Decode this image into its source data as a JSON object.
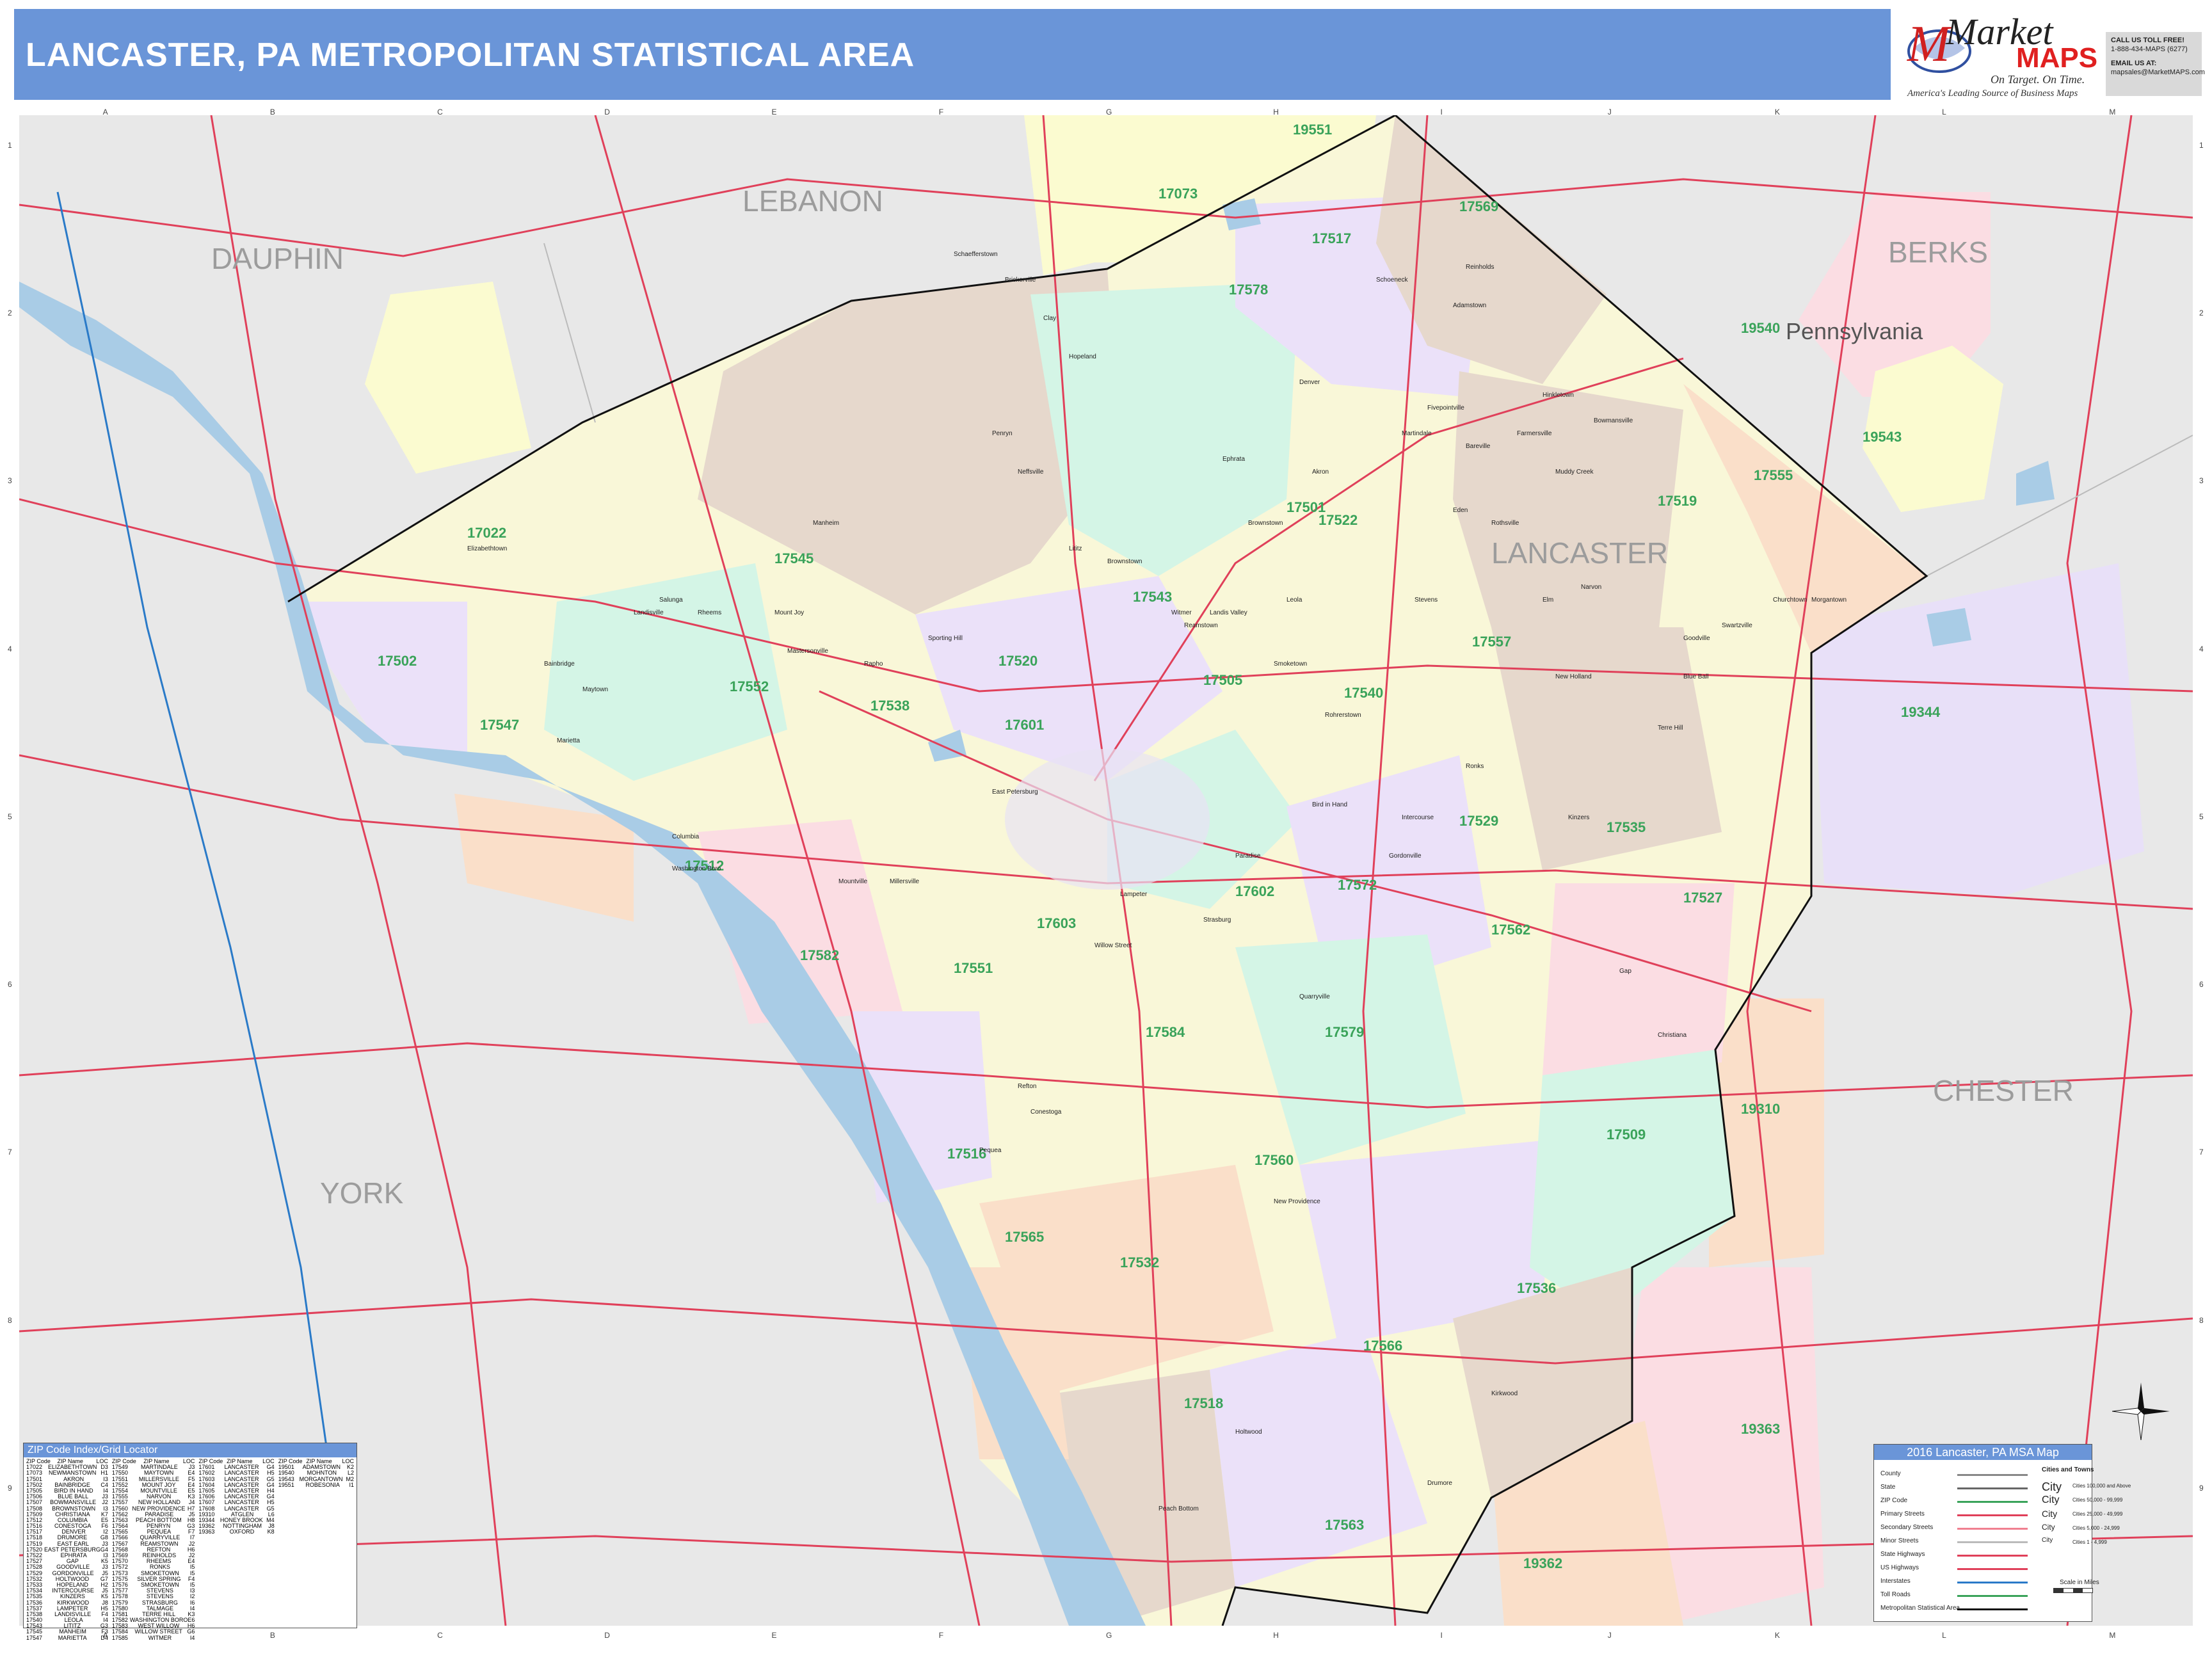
{
  "header": {
    "title": "LANCASTER, PA METROPOLITAN STATISTICAL AREA"
  },
  "logo": {
    "market": "Market",
    "maps": "MAPS",
    "tagline": "On Target. On Time.",
    "subtitle": "America's Leading Source of Business Maps"
  },
  "contact": {
    "line1": "CALL US TOLL FREE!",
    "line2": "1-888-434-MAPS (6277)",
    "line3": "EMAIL US AT:",
    "line4": "mapsales@MarketMAPS.com"
  },
  "grid": {
    "columns": [
      "A",
      "B",
      "C",
      "D",
      "E",
      "F",
      "G",
      "H",
      "I",
      "J",
      "K",
      "L",
      "M"
    ],
    "rows": [
      "1",
      "2",
      "3",
      "4",
      "5",
      "6",
      "7",
      "8",
      "9"
    ]
  },
  "counties": [
    {
      "name": "LEBANON"
    },
    {
      "name": "DAUPHIN"
    },
    {
      "name": "BERKS"
    },
    {
      "name": "LANCASTER"
    },
    {
      "name": "CHESTER"
    },
    {
      "name": "YORK"
    }
  ],
  "state_label": "Pennsylvania",
  "zip_codes": [
    "19551",
    "17073",
    "17569",
    "17517",
    "17578",
    "19540",
    "19543",
    "17555",
    "17519",
    "17522",
    "17501",
    "17022",
    "17545",
    "17543",
    "17502",
    "17552",
    "17538",
    "17601",
    "17520",
    "17505",
    "17540",
    "17557",
    "19344",
    "17547",
    "17512",
    "17603",
    "17529",
    "17535",
    "17527",
    "17602",
    "17572",
    "17562",
    "17582",
    "17551",
    "17584",
    "17579",
    "17509",
    "19310",
    "17516",
    "17560",
    "17565",
    "17532",
    "17536",
    "17566",
    "17518",
    "17563",
    "19362",
    "19363"
  ],
  "towns": [
    "Elizabethtown",
    "Mount Joy",
    "Manheim",
    "Lititz",
    "Ephrata",
    "Akron",
    "Denver",
    "Adamstown",
    "Reinholds",
    "Schoeneck",
    "Brownstown",
    "Leola",
    "Bird in Hand",
    "Intercourse",
    "Gordonville",
    "Paradise",
    "Strasburg",
    "Willow Street",
    "Millersville",
    "Columbia",
    "Marietta",
    "Maytown",
    "Bainbridge",
    "Landisville",
    "Salunga",
    "Rheems",
    "Quarryville",
    "Christiana",
    "Gap",
    "Kinzers",
    "Ronks",
    "Holtwood",
    "Peach Bottom",
    "Kirkwood",
    "Drumore",
    "New Providence",
    "Refton",
    "Lampeter",
    "Mountville",
    "Washington Boro",
    "Conestoga",
    "Pequea",
    "Narvon",
    "New Holland",
    "Blue Ball",
    "Terre Hill",
    "Goodville",
    "Churchtown",
    "Morgantown",
    "Elm",
    "Brickerville",
    "Schaefferstown",
    "Clay",
    "Hopeland",
    "Penryn",
    "Mastersonville",
    "Rapho",
    "Sporting Hill",
    "East Petersburg",
    "Neffsville",
    "Rohrerstown",
    "Landis Valley",
    "Witmer",
    "Smoketown",
    "Eden",
    "Rothsville",
    "Farmersville",
    "Bareville",
    "Hinkletown",
    "Martindale",
    "Fivepointville",
    "Bowmansville",
    "Muddy Creek",
    "Swartzville",
    "Reamstown",
    "Stevens",
    "Brownstown"
  ],
  "index": {
    "title": "ZIP Code Index/Grid Locator",
    "headers": [
      "ZIP Code",
      "ZIP Name",
      "LOC"
    ],
    "col1": [
      [
        "17022",
        "ELIZABETHTOWN",
        "D3"
      ],
      [
        "17073",
        "NEWMANSTOWN",
        "H1"
      ],
      [
        "17501",
        "AKRON",
        "I3"
      ],
      [
        "17502",
        "BAINBRIDGE",
        "C4"
      ],
      [
        "17505",
        "BIRD IN HAND",
        "I4"
      ],
      [
        "17506",
        "BLUE BALL",
        "J3"
      ],
      [
        "17507",
        "BOWMANSVILLE",
        "J2"
      ],
      [
        "17508",
        "BROWNSTOWN",
        "I3"
      ],
      [
        "17509",
        "CHRISTIANA",
        "K7"
      ],
      [
        "17512",
        "COLUMBIA",
        "E5"
      ],
      [
        "17516",
        "CONESTOGA",
        "F6"
      ],
      [
        "17517",
        "DENVER",
        "I2"
      ],
      [
        "17518",
        "DRUMORE",
        "G8"
      ],
      [
        "17519",
        "EAST EARL",
        "J3"
      ],
      [
        "17520",
        "EAST PETERSBURG",
        "G4"
      ],
      [
        "17522",
        "EPHRATA",
        "I3"
      ],
      [
        "17527",
        "GAP",
        "K5"
      ],
      [
        "17528",
        "GOODVILLE",
        "J3"
      ],
      [
        "17529",
        "GORDONVILLE",
        "J5"
      ],
      [
        "17532",
        "HOLTWOOD",
        "G7"
      ],
      [
        "17533",
        "HOPELAND",
        "H2"
      ],
      [
        "17534",
        "INTERCOURSE",
        "J5"
      ],
      [
        "17535",
        "KINZERS",
        "K5"
      ],
      [
        "17536",
        "KIRKWOOD",
        "J8"
      ],
      [
        "17537",
        "LAMPETER",
        "H5"
      ],
      [
        "17538",
        "LANDISVILLE",
        "F4"
      ],
      [
        "17540",
        "LEOLA",
        "I4"
      ],
      [
        "17543",
        "LITITZ",
        "G3"
      ],
      [
        "17545",
        "MANHEIM",
        "F3"
      ],
      [
        "17547",
        "MARIETTA",
        "D4"
      ]
    ],
    "col2": [
      [
        "17549",
        "MARTINDALE",
        "J3"
      ],
      [
        "17550",
        "MAYTOWN",
        "E4"
      ],
      [
        "17551",
        "MILLERSVILLE",
        "F5"
      ],
      [
        "17552",
        "MOUNT JOY",
        "E4"
      ],
      [
        "17554",
        "MOUNTVILLE",
        "E5"
      ],
      [
        "17555",
        "NARVON",
        "K3"
      ],
      [
        "17557",
        "NEW HOLLAND",
        "J4"
      ],
      [
        "17560",
        "NEW PROVIDENCE",
        "H7"
      ],
      [
        "17562",
        "PARADISE",
        "J5"
      ],
      [
        "17563",
        "PEACH BOTTOM",
        "H8"
      ],
      [
        "17564",
        "PENRYN",
        "G3"
      ],
      [
        "17565",
        "PEQUEA",
        "F7"
      ],
      [
        "17566",
        "QUARRYVILLE",
        "I7"
      ],
      [
        "17567",
        "REAMSTOWN",
        "J2"
      ],
      [
        "17568",
        "REFTON",
        "H6"
      ],
      [
        "17569",
        "REINHOLDS",
        "J2"
      ],
      [
        "17570",
        "RHEEMS",
        "E4"
      ],
      [
        "17572",
        "RONKS",
        "I5"
      ],
      [
        "17573",
        "SMOKETOWN",
        "I5"
      ],
      [
        "17575",
        "SILVER SPRING",
        "F4"
      ],
      [
        "17576",
        "SMOKETOWN",
        "I5"
      ],
      [
        "17577",
        "STEVENS",
        "I3"
      ],
      [
        "17578",
        "STEVENS",
        "I2"
      ],
      [
        "17579",
        "STRASBURG",
        "I6"
      ],
      [
        "17580",
        "TALMAGE",
        "I4"
      ],
      [
        "17581",
        "TERRE HILL",
        "K3"
      ],
      [
        "17582",
        "WASHINGTON BORO",
        "E6"
      ],
      [
        "17583",
        "WEST WILLOW",
        "H6"
      ],
      [
        "17584",
        "WILLOW STREET",
        "G6"
      ],
      [
        "17585",
        "WITMER",
        "I4"
      ]
    ],
    "col3": [
      [
        "17601",
        "LANCASTER",
        "G4"
      ],
      [
        "17602",
        "LANCASTER",
        "H5"
      ],
      [
        "17603",
        "LANCASTER",
        "G5"
      ],
      [
        "17604",
        "LANCASTER",
        "G4"
      ],
      [
        "17605",
        "LANCASTER",
        "H4"
      ],
      [
        "17606",
        "LANCASTER",
        "G4"
      ],
      [
        "17607",
        "LANCASTER",
        "H5"
      ],
      [
        "17608",
        "LANCASTER",
        "G5"
      ],
      [
        "19310",
        "ATGLEN",
        "L6"
      ],
      [
        "19344",
        "HONEY BROOK",
        "M4"
      ],
      [
        "19362",
        "NOTTINGHAM",
        "J8"
      ],
      [
        "19363",
        "OXFORD",
        "K8"
      ]
    ],
    "col4": [
      [
        "19501",
        "ADAMSTOWN",
        "K2"
      ],
      [
        "19540",
        "MOHNTON",
        "L2"
      ],
      [
        "19543",
        "MORGANTOWN",
        "M2"
      ],
      [
        "19551",
        "ROBESONIA",
        "I1"
      ]
    ]
  },
  "legend": {
    "title": "2016 Lancaster, PA MSA Map",
    "items": [
      "County",
      "State",
      "ZIP Code",
      "Primary Streets",
      "Secondary Streets",
      "Minor Streets",
      "State Highways",
      "US Highways",
      "Interstates",
      "Toll Roads",
      "Metropolitan Statistical Area"
    ],
    "cities_title": "Cities and Towns",
    "cities": [
      [
        "City",
        "Cities 100,000 and Above"
      ],
      [
        "City",
        "Cities 50,000 - 99,999"
      ],
      [
        "City",
        "Cities 25,000 - 49,999"
      ],
      [
        "City",
        "Cities 5,000 - 24,999"
      ],
      [
        "City",
        "Cities 1 - 4,999"
      ]
    ],
    "scale_label": "Scale in Miles"
  },
  "colors": {
    "header_bg": "#6a95d8",
    "water": "#a9cce6",
    "outside": "#e8e8e8",
    "zip_label": "#3aa35a",
    "road_state": "#e0405a",
    "msa_border": "#111111"
  }
}
